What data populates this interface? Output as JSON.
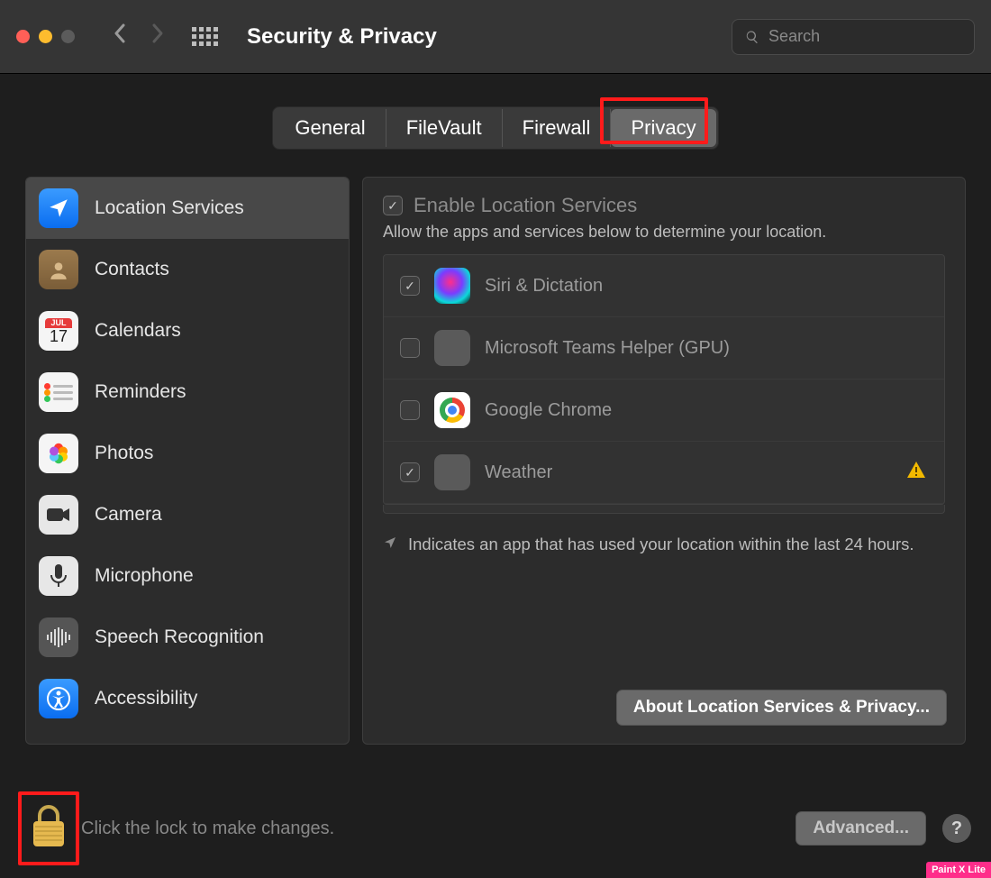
{
  "window": {
    "title": "Security & Privacy"
  },
  "search": {
    "placeholder": "Search"
  },
  "tabs": {
    "general": "General",
    "filevault": "FileVault",
    "firewall": "Firewall",
    "privacy": "Privacy",
    "selected": "Privacy"
  },
  "sidebar": {
    "items": [
      {
        "label": "Location Services",
        "icon": "location-arrow",
        "selected": true
      },
      {
        "label": "Contacts",
        "icon": "contacts"
      },
      {
        "label": "Calendars",
        "icon": "calendar",
        "badge_month": "JUL",
        "badge_day": "17"
      },
      {
        "label": "Reminders",
        "icon": "reminders"
      },
      {
        "label": "Photos",
        "icon": "photos"
      },
      {
        "label": "Camera",
        "icon": "camera"
      },
      {
        "label": "Microphone",
        "icon": "microphone"
      },
      {
        "label": "Speech Recognition",
        "icon": "speech"
      },
      {
        "label": "Accessibility",
        "icon": "accessibility"
      }
    ]
  },
  "detail": {
    "enable_label": "Enable Location Services",
    "enable_checked": true,
    "description": "Allow the apps and services below to determine your location.",
    "apps": [
      {
        "name": "Siri & Dictation",
        "checked": true,
        "icon": "siri"
      },
      {
        "name": "Microsoft Teams Helper (GPU)",
        "checked": false,
        "icon": "generic"
      },
      {
        "name": "Google Chrome",
        "checked": false,
        "icon": "chrome"
      },
      {
        "name": "Weather",
        "checked": true,
        "icon": "generic",
        "warning": true
      }
    ],
    "indicator_text": "Indicates an app that has used your location within the last 24 hours.",
    "about_button": "About Location Services & Privacy..."
  },
  "footer": {
    "lock_text": "Click the lock to make changes.",
    "advanced_button": "Advanced...",
    "help_label": "?"
  },
  "watermark": "Paint X Lite"
}
